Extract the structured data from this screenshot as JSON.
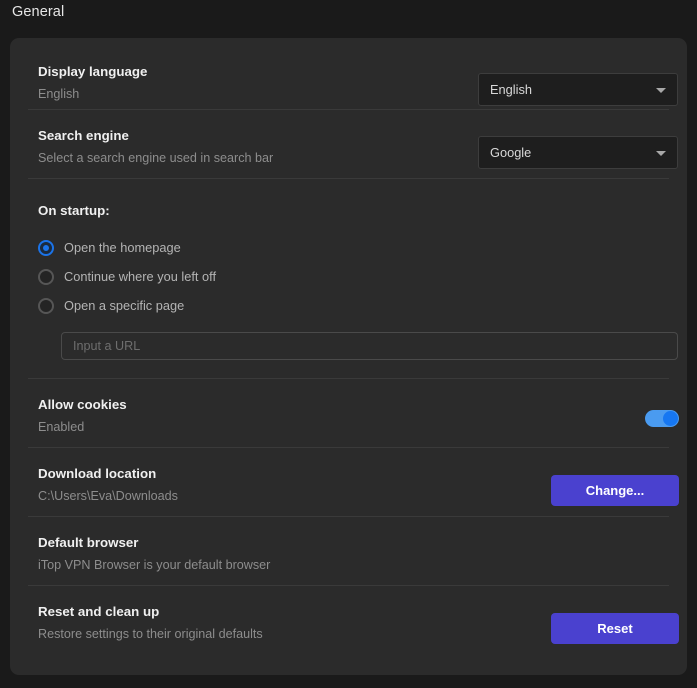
{
  "header": {
    "title": "General"
  },
  "settings": {
    "display_language": {
      "title": "Display language",
      "subtitle": "English",
      "dropdown_value": "English"
    },
    "search_engine": {
      "title": "Search engine",
      "subtitle": "Select a search engine used in search bar",
      "dropdown_value": "Google"
    },
    "on_startup": {
      "title": "On startup:",
      "options": [
        {
          "label": "Open the homepage",
          "selected": true
        },
        {
          "label": "Continue where you left off",
          "selected": false
        },
        {
          "label": "Open a specific page",
          "selected": false
        }
      ],
      "url_placeholder": "Input a URL",
      "url_value": ""
    },
    "allow_cookies": {
      "title": "Allow cookies",
      "subtitle": "Enabled",
      "toggle_state": "on"
    },
    "download_location": {
      "title": "Download location",
      "subtitle": "C:\\Users\\Eva\\Downloads",
      "button_label": "Change..."
    },
    "default_browser": {
      "title": "Default browser",
      "subtitle": "iTop VPN Browser is your default browser"
    },
    "reset": {
      "title": "Reset and clean up",
      "subtitle": "Restore settings to their original defaults",
      "button_label": "Reset"
    }
  },
  "colors": {
    "accent_button": "#4a41cf",
    "toggle_on": "#4a9bf0",
    "radio_selected": "#1b73e8",
    "panel_bg": "#2b2b2b",
    "page_bg": "#1a1a1a"
  }
}
